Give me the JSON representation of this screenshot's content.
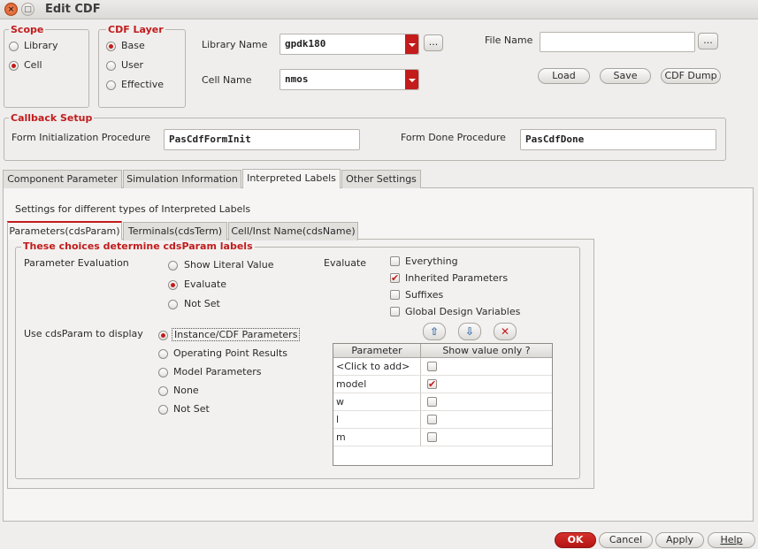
{
  "window": {
    "title": "Edit CDF",
    "close_glyph": "×",
    "max_glyph": "□"
  },
  "scope": {
    "title": "Scope",
    "options": [
      {
        "label": "Library",
        "selected": false
      },
      {
        "label": "Cell",
        "selected": true
      }
    ]
  },
  "cdf_layer": {
    "title": "CDF Layer",
    "options": [
      {
        "label": "Base",
        "selected": true
      },
      {
        "label": "User",
        "selected": false
      },
      {
        "label": "Effective",
        "selected": false
      }
    ]
  },
  "library": {
    "label": "Library Name",
    "value": "gpdk180",
    "browse": "..."
  },
  "cell": {
    "label": "Cell Name",
    "value": "nmos"
  },
  "file": {
    "label": "File Name",
    "value": "",
    "browse": "..."
  },
  "file_buttons": {
    "load": "Load",
    "save": "Save",
    "dump": "CDF Dump"
  },
  "callback": {
    "title": "Callback Setup",
    "init_label": "Form Initialization Procedure",
    "init_value": "PasCdfFormInit",
    "done_label": "Form Done Procedure",
    "done_value": "PasCdfDone"
  },
  "tabs": [
    "Component Parameter",
    "Simulation Information",
    "Interpreted Labels",
    "Other Settings"
  ],
  "active_tab": "Interpreted Labels",
  "panel_caption": "Settings for different types of Interpreted Labels",
  "subtabs": [
    "Parameters(cdsParam)",
    "Terminals(cdsTerm)",
    "Cell/Inst Name(cdsName)"
  ],
  "active_subtab": "Parameters(cdsParam)",
  "choices": {
    "title": "These choices determine cdsParam labels",
    "param_eval_label": "Parameter Evaluation",
    "param_eval_options": [
      {
        "label": "Show Literal Value",
        "selected": false
      },
      {
        "label": "Evaluate",
        "selected": true
      },
      {
        "label": "Not Set",
        "selected": false
      }
    ],
    "evaluate_label": "Evaluate",
    "evaluate_options": [
      {
        "label": "Everything",
        "checked": false
      },
      {
        "label": "Inherited Parameters",
        "checked": true
      },
      {
        "label": "Suffixes",
        "checked": false
      },
      {
        "label": "Global Design Variables",
        "checked": false
      }
    ],
    "display_label": "Use cdsParam to display",
    "display_options": [
      {
        "label": "Instance/CDF Parameters",
        "selected": true
      },
      {
        "label": "Operating Point Results",
        "selected": false
      },
      {
        "label": "Model Parameters",
        "selected": false
      },
      {
        "label": "None",
        "selected": false
      },
      {
        "label": "Not Set",
        "selected": false
      }
    ]
  },
  "table_tools": {
    "up_icon": "⇧",
    "down_icon": "⇩",
    "delete_icon": "✕"
  },
  "table": {
    "columns": [
      "Parameter",
      "Show value only ?"
    ],
    "rows": [
      {
        "name": "<Click to add>",
        "show": false
      },
      {
        "name": "model",
        "show": true
      },
      {
        "name": "w",
        "show": false
      },
      {
        "name": "l",
        "show": false
      },
      {
        "name": "m",
        "show": false
      }
    ]
  },
  "check_glyph": "✔",
  "footer": {
    "ok": "OK",
    "cancel": "Cancel",
    "apply": "Apply",
    "help": "Help"
  }
}
